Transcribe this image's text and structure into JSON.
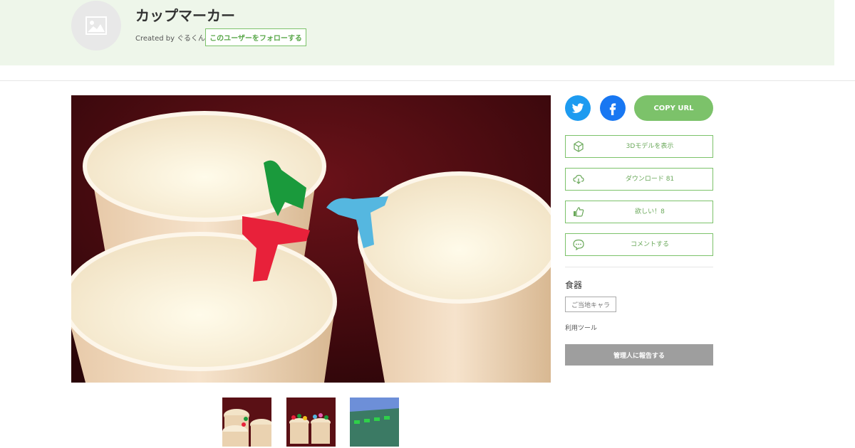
{
  "header": {
    "title": "カップマーカー",
    "created_by": "Created by ぐるくん",
    "follow_label": "このユーザーをフォローする"
  },
  "share": {
    "twitter_icon": "twitter-icon",
    "facebook_icon": "facebook-icon",
    "copy_url_label": "COPY URL"
  },
  "actions": [
    {
      "icon": "cube-icon",
      "label": "3Dモデルを表示"
    },
    {
      "icon": "cloud-download-icon",
      "label": "ダウンロード 81"
    },
    {
      "icon": "thumbs-up-icon",
      "label": "欲しい！8"
    },
    {
      "icon": "comment-icon",
      "label": "コメントする"
    }
  ],
  "category": "食器",
  "tags": [
    "ご当地キャラ"
  ],
  "tools_label": "利用ツール",
  "report_label": "管理人に報告する",
  "colors": {
    "accent": "#7cc26a",
    "header_bg": "#eef6ea",
    "twitter": "#1d9bf0",
    "facebook": "#1877f2",
    "report_bg": "#9e9e9e"
  }
}
